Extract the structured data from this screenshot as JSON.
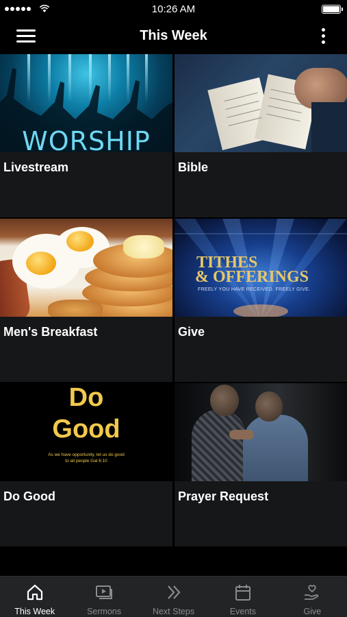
{
  "status_bar": {
    "time": "10:26 AM"
  },
  "nav": {
    "title": "This Week"
  },
  "tiles": [
    {
      "label": "Livestream",
      "thumb_text": "WORSHIP"
    },
    {
      "label": "Bible"
    },
    {
      "label": "Men's Breakfast"
    },
    {
      "label": "Give",
      "thumb_line1": "TITHES",
      "thumb_line2": "& OFFERINGS",
      "thumb_sub": "FREELY YOU HAVE RECEIVED. FREELY GIVE."
    },
    {
      "label": "Do Good",
      "thumb_line1": "Do",
      "thumb_line2": "Good",
      "thumb_verse_1": "As we have opportunity, let us do good",
      "thumb_verse_2": "to all people  Gal 6:10"
    },
    {
      "label": "Prayer Request"
    }
  ],
  "tab_bar": {
    "active_index": 0,
    "tabs": [
      {
        "label": "This Week",
        "icon": "home-icon"
      },
      {
        "label": "Sermons",
        "icon": "play-video-icon"
      },
      {
        "label": "Next Steps",
        "icon": "double-chevron-right-icon"
      },
      {
        "label": "Events",
        "icon": "calendar-icon"
      },
      {
        "label": "Give",
        "icon": "heart-hand-icon"
      }
    ]
  },
  "colors": {
    "background": "#000000",
    "tile_background": "#161719",
    "tab_bar_background": "#232426",
    "tab_inactive": "#8b8c8f",
    "tab_active": "#ffffff"
  }
}
